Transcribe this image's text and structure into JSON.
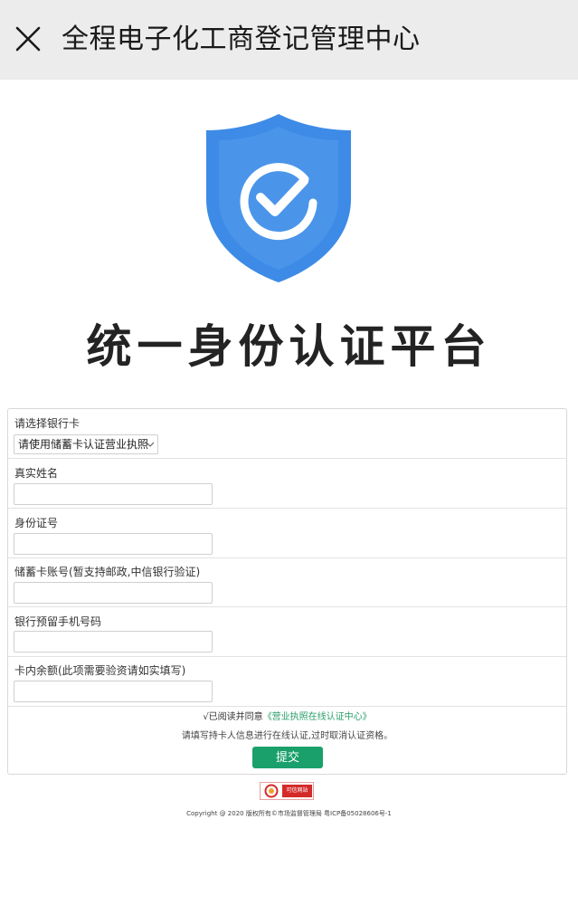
{
  "topbar": {
    "title": "全程电子化工商登记管理中心",
    "close_icon": "close-icon"
  },
  "hero": {
    "shield_icon": "shield-check-icon",
    "shield_colors": {
      "outer": "#3d8be6",
      "inner": "#ffffff"
    },
    "title": "统一身份认证平台"
  },
  "form": {
    "bank": {
      "label": "请选择银行卡",
      "selected": "请使用储蓄卡认证营业执照"
    },
    "name": {
      "label": "真实姓名",
      "value": ""
    },
    "id_number": {
      "label": "身份证号",
      "value": ""
    },
    "card_number": {
      "label": "储蓄卡账号(暂支持邮政,中信银行验证)",
      "value": ""
    },
    "phone": {
      "label": "银行预留手机号码",
      "value": ""
    },
    "balance": {
      "label": "卡内余额(此项需要验资请如实填写)",
      "value": ""
    },
    "agree_prefix": "√已阅读并同意",
    "agree_link": "《营业执照在线认证中心》",
    "notice": "请填写持卡人信息进行在线认证,过时取消认证资格。",
    "submit_label": "提交",
    "submit_color": "#1aa06b",
    "link_color": "#2a9d6a"
  },
  "badge": {
    "icon": "trust-seal-icon",
    "text": "可信网站"
  },
  "footer": {
    "copyright": "Copyright @ 2020 版权所有©市场监督管理局   粤ICP备05028606号-1"
  }
}
